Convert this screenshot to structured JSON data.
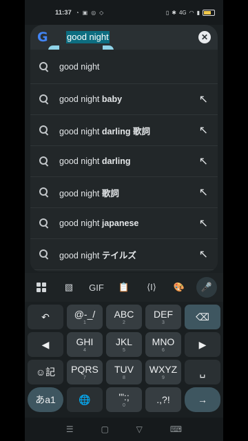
{
  "status_bar": {
    "time": "11:37",
    "left_icons": [
      "chat-bubble-icon",
      "image-icon",
      "notification-icon",
      "wifi-off-icon"
    ],
    "network": "4G",
    "battery_percent": "61"
  },
  "search": {
    "query": "good night",
    "clear_icon": "close-icon"
  },
  "suggestions": [
    {
      "prefix": "good night",
      "suffix": "",
      "arrow": false
    },
    {
      "prefix": "good night ",
      "suffix": "baby",
      "arrow": true
    },
    {
      "prefix": "good night ",
      "suffix": "darling 歌詞",
      "arrow": true
    },
    {
      "prefix": "good night ",
      "suffix": "darling",
      "arrow": true
    },
    {
      "prefix": "good night ",
      "suffix": "歌詞",
      "arrow": true
    },
    {
      "prefix": "good night ",
      "suffix": "japanese",
      "arrow": true
    },
    {
      "prefix": "good night ",
      "suffix": "テイルズ",
      "arrow": true
    }
  ],
  "keyboard_toolbar": {
    "gif_label": "GIF"
  },
  "keyboard": {
    "row1": [
      {
        "label": "↶",
        "sub": ""
      },
      {
        "label": "@-_/",
        "sub": "1"
      },
      {
        "label": "ABC",
        "sub": "2"
      },
      {
        "label": "DEF",
        "sub": "3"
      },
      {
        "label": "⌫",
        "sub": ""
      }
    ],
    "row2": [
      {
        "label": "◀",
        "sub": ""
      },
      {
        "label": "GHI",
        "sub": "4"
      },
      {
        "label": "JKL",
        "sub": "5"
      },
      {
        "label": "MNO",
        "sub": "6"
      },
      {
        "label": "▶",
        "sub": ""
      }
    ],
    "row3": [
      {
        "label": "☺記",
        "sub": ""
      },
      {
        "label": "PQRS",
        "sub": "7"
      },
      {
        "label": "TUV",
        "sub": "8"
      },
      {
        "label": "WXYZ",
        "sub": "9"
      },
      {
        "label": "␣",
        "sub": ""
      }
    ],
    "row4": [
      {
        "label": "あa1",
        "sub": ""
      },
      {
        "label": "🌐",
        "sub": ""
      },
      {
        "label": "'\":;",
        "sub": "0"
      },
      {
        "label": ".,?!",
        "sub": ""
      },
      {
        "label": "→",
        "sub": ""
      }
    ]
  },
  "nav_bar": {
    "menu": "☰",
    "home": "▢",
    "back": "▽",
    "keyboard": "⌨"
  }
}
